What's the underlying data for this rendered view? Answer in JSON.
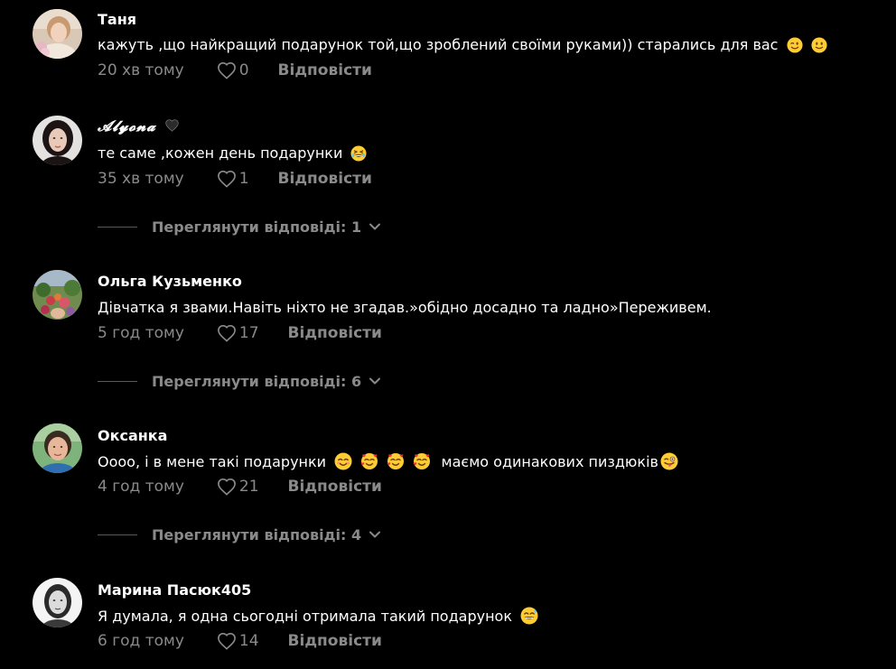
{
  "comments": [
    {
      "username": "Таня",
      "text": "кажуть ,що найкращий подарунок той,що зроблений своїми руками)) старались для вас",
      "time": "20 хв тому",
      "likes": "0",
      "reply_label": "Відповісти"
    },
    {
      "username": "𝓐𝓵𝔂𝓸𝓷𝓪",
      "text": "те саме ,кожен день подарунки",
      "time": "35 хв тому",
      "likes": "1",
      "reply_label": "Відповісти",
      "view_replies": "Переглянути відповіді: 1"
    },
    {
      "username": "Ольга Кузьменко",
      "text": "Дівчатка я звами.Навіть ніхто не згадав.»обідно досадно та ладно»Переживем.",
      "time": "5 год тому",
      "likes": "17",
      "reply_label": "Відповісти",
      "view_replies": "Переглянути відповіді: 6"
    },
    {
      "username": "Оксанка",
      "text_part1": "Оооо, і в мене такі подарунки",
      "text_part2": "маємо одинакових пиздюків",
      "time": "4 год тому",
      "likes": "21",
      "reply_label": "Відповісти",
      "view_replies": "Переглянути відповіді: 4"
    },
    {
      "username": "Марина Пасюк405",
      "text": "Я думала, я одна сьогодні отримала такий подарунок",
      "time": "6 год тому",
      "likes": "14",
      "reply_label": "Відповісти"
    }
  ],
  "icons": {
    "like": "heart-outline-icon",
    "expand": "chevron-down-icon",
    "user_badge": "black-heart-icon",
    "emoji_wink": "winking-face-emoji",
    "emoji_smile": "slightly-smiling-face-emoji",
    "emoji_laugh": "grinning-squinting-face-emoji",
    "emoji_blush": "smiling-face-with-smiling-eyes-emoji",
    "emoji_hearts": "smiling-face-with-hearts-emoji",
    "emoji_tongue": "winking-face-with-tongue-emoji",
    "emoji_sweat": "grinning-face-with-sweat-emoji"
  },
  "colors": {
    "background": "#000000",
    "primary_text": "#ffffff",
    "secondary_text": "#8a8a8a",
    "divider": "#5a5a5a"
  }
}
